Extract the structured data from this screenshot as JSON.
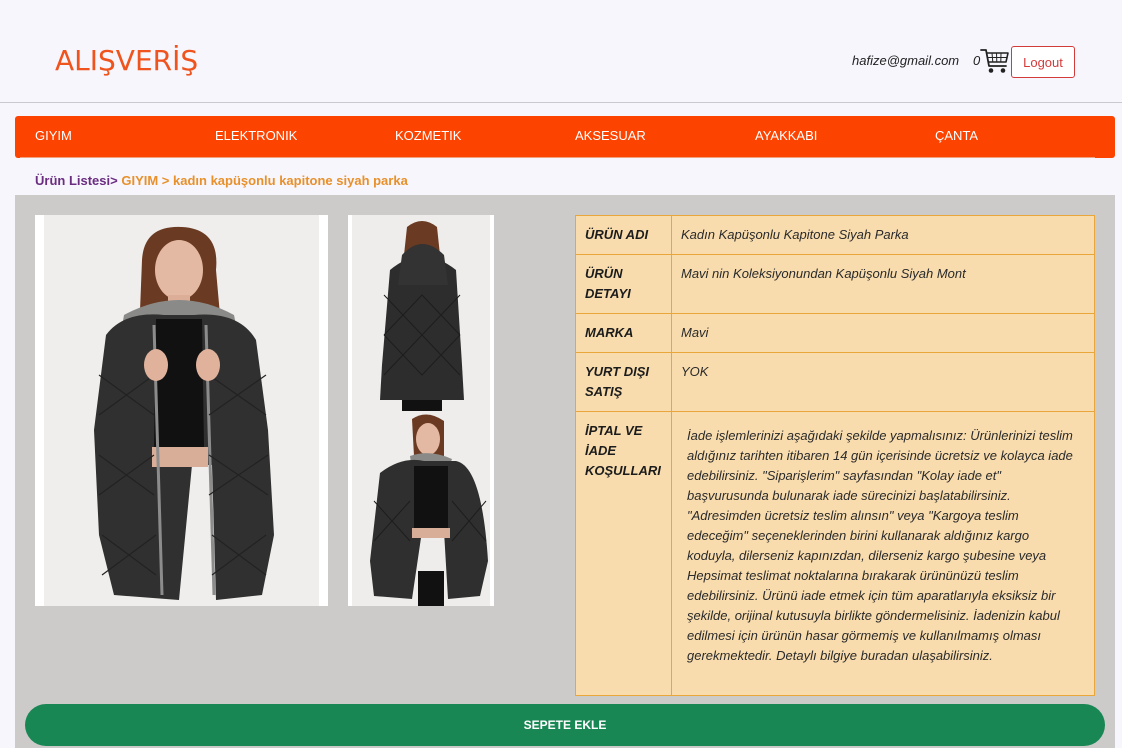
{
  "brand": {
    "logo": "ALIŞVERİŞ"
  },
  "header": {
    "user_email": "hafize@gmail.com",
    "cart_count": "0",
    "logout_label": "Logout"
  },
  "nav": {
    "items": [
      {
        "label": "GIYIM"
      },
      {
        "label": "ELEKTRONIK"
      },
      {
        "label": "KOZMETIK"
      },
      {
        "label": "AKSESUAR"
      },
      {
        "label": "AYAKKABI"
      },
      {
        "label": "ÇANTA"
      }
    ]
  },
  "breadcrumb": {
    "root": "Ürün Listesi",
    "sep1": ">",
    "category": "GIYIM",
    "sep2": " > ",
    "product": "kadın kapüşonlu kapitone siyah parka"
  },
  "product": {
    "rows": [
      {
        "key": "ÜRÜN ADI",
        "value": "Kadın Kapüşonlu Kapitone Siyah Parka"
      },
      {
        "key": "ÜRÜN DETAYI",
        "value": "Mavi nin Koleksiyonundan Kapüşonlu Siyah Mont"
      },
      {
        "key": "MARKA",
        "value": "Mavi"
      },
      {
        "key": "YURT DIŞI SATIŞ",
        "value": "YOK"
      },
      {
        "key": "İPTAL VE İADE KOŞULLARI",
        "value": "İade işlemlerinizi aşağıdaki şekilde yapmalısınız: Ürünlerinizi teslim aldığınız tarihten itibaren 14 gün içerisinde ücretsiz ve kolayca iade edebilirsiniz. \"Siparişlerim\" sayfasından \"Kolay iade et\" başvurusunda bulunarak iade sürecinizi başlatabilirsiniz. \"Adresimden ücretsiz teslim alınsın\" veya \"Kargoya teslim edeceğim\" seçeneklerinden birini kullanarak aldığınız kargo koduyla, dilerseniz kapınızdan, dilerseniz kargo şubesine veya Hepsimat teslimat noktalarına bırakarak ürününüzü teslim edebilirsiniz. Ürünü iade etmek için tüm aparatlarıyla eksiksiz bir şekilde, orijinal kutusuyla birlikte göndermelisiniz. İadenizin kabul edilmesi için ürünün hasar görmemiş ve kullanılmamış olması gerekmektedir. Detaylı bilgiye buradan ulaşabilirsiniz."
      }
    ],
    "add_to_cart_label": "SEPETE EKLE"
  },
  "colors": {
    "brand": "#f0541e",
    "nav_bg": "#fd4300",
    "table_bg": "#f8dcae",
    "table_border": "#e9a63a",
    "button": "#198754",
    "logout": "#d33b3b"
  },
  "icons": {
    "cart": "shopping-cart-icon"
  }
}
